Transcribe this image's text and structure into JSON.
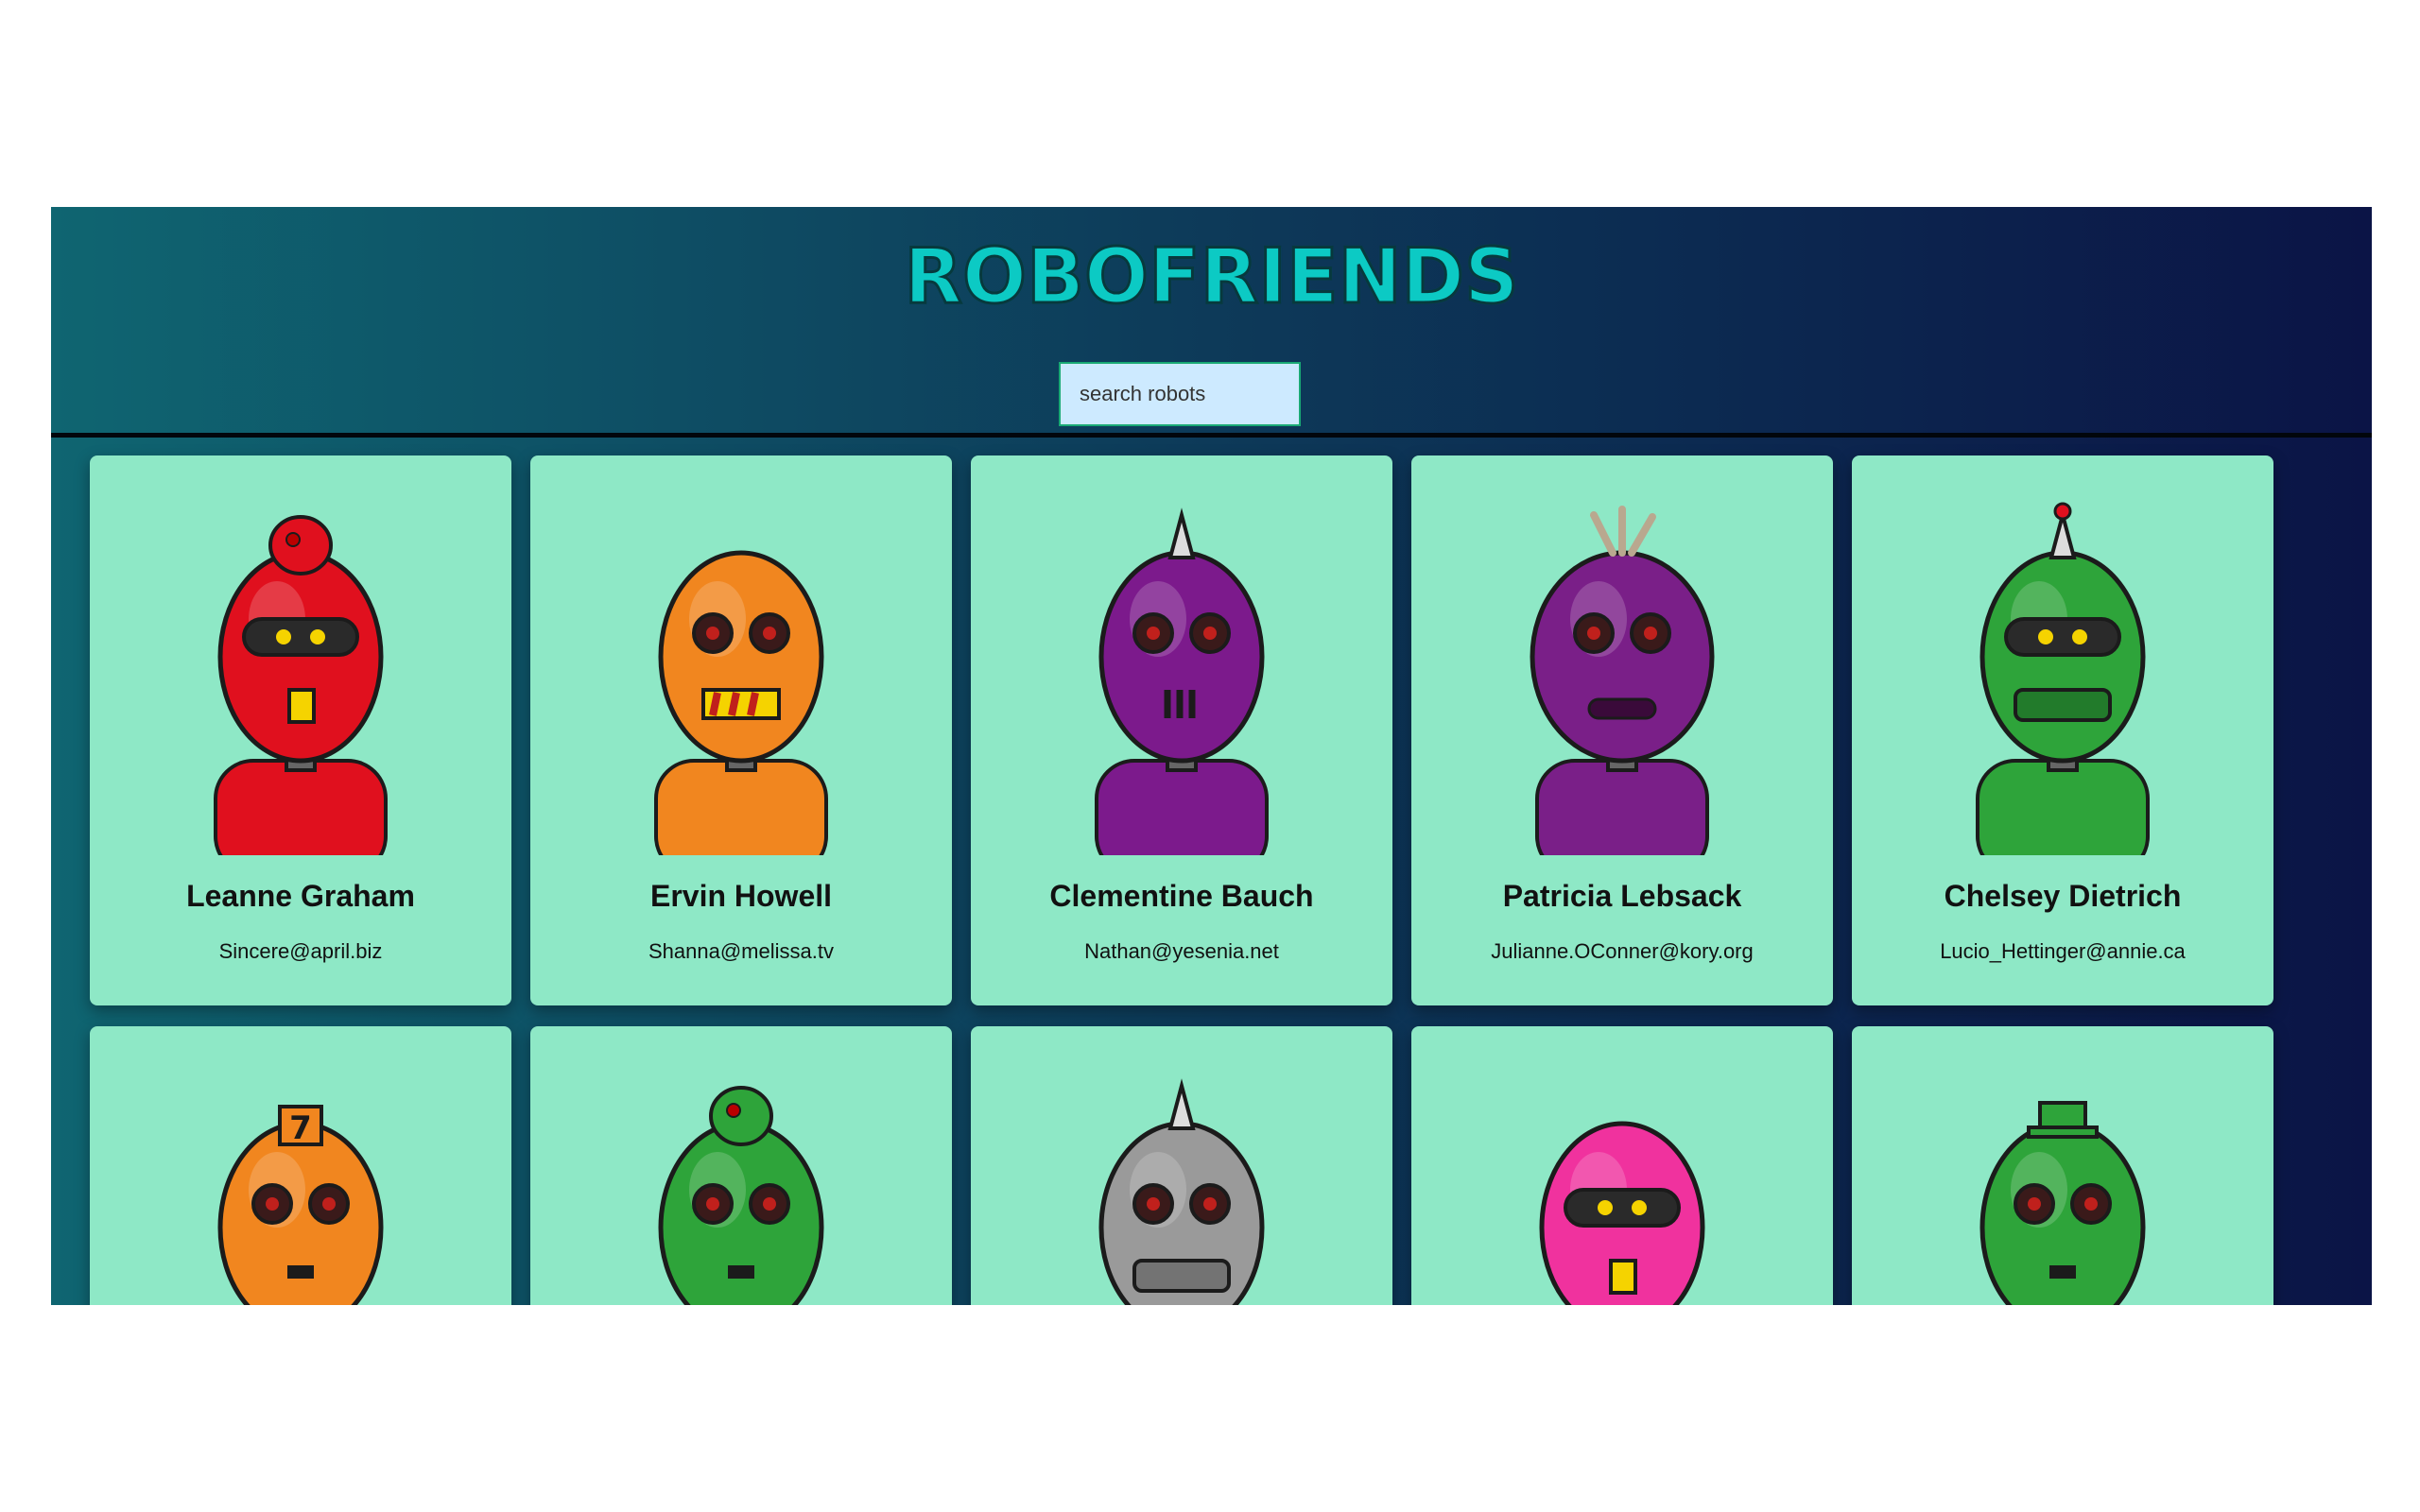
{
  "app": {
    "title": "ROBOFRIENDS",
    "colors": {
      "card_bg": "#8ee8c6",
      "logo": "#0ccac4",
      "search_bg": "#cdeaff"
    }
  },
  "search": {
    "placeholder": "search robots",
    "value": ""
  },
  "robots": [
    {
      "name": "Leanne Graham",
      "email": "Sincere@april.biz",
      "color": "#e0101e",
      "visor": true,
      "mouth": "tooth",
      "head": "dome-red"
    },
    {
      "name": "Ervin Howell",
      "email": "Shanna@melissa.tv",
      "color": "#f1861f",
      "visor": false,
      "mouth": "grill",
      "head": "oval"
    },
    {
      "name": "Clementine Bauch",
      "email": "Nathan@yesenia.net",
      "color": "#7c1a8c",
      "visor": false,
      "mouth": "vent",
      "head": "horn"
    },
    {
      "name": "Patricia Lebsack",
      "email": "Julianne.OConner@kory.org",
      "color": "#7a1f88",
      "visor": false,
      "mouth": "slot",
      "head": "box"
    },
    {
      "name": "Chelsey Dietrich",
      "email": "Lucio_Hettinger@annie.ca",
      "color": "#2ea43a",
      "visor": true,
      "mouth": "jaw",
      "head": "antenna"
    },
    {
      "name": "",
      "email": "",
      "color": "#f1861f",
      "visor": false,
      "mouth": "line",
      "head": "seven"
    },
    {
      "name": "",
      "email": "",
      "color": "#2ea43a",
      "visor": false,
      "mouth": "line",
      "head": "cap"
    },
    {
      "name": "",
      "email": "",
      "color": "#9a9a9a",
      "visor": false,
      "mouth": "jaw",
      "head": "horn"
    },
    {
      "name": "",
      "email": "",
      "color": "#f0329e",
      "visor": true,
      "mouth": "tooth",
      "head": "plain"
    },
    {
      "name": "",
      "email": "",
      "color": "#2ea43a",
      "visor": false,
      "mouth": "line",
      "head": "hat"
    }
  ]
}
